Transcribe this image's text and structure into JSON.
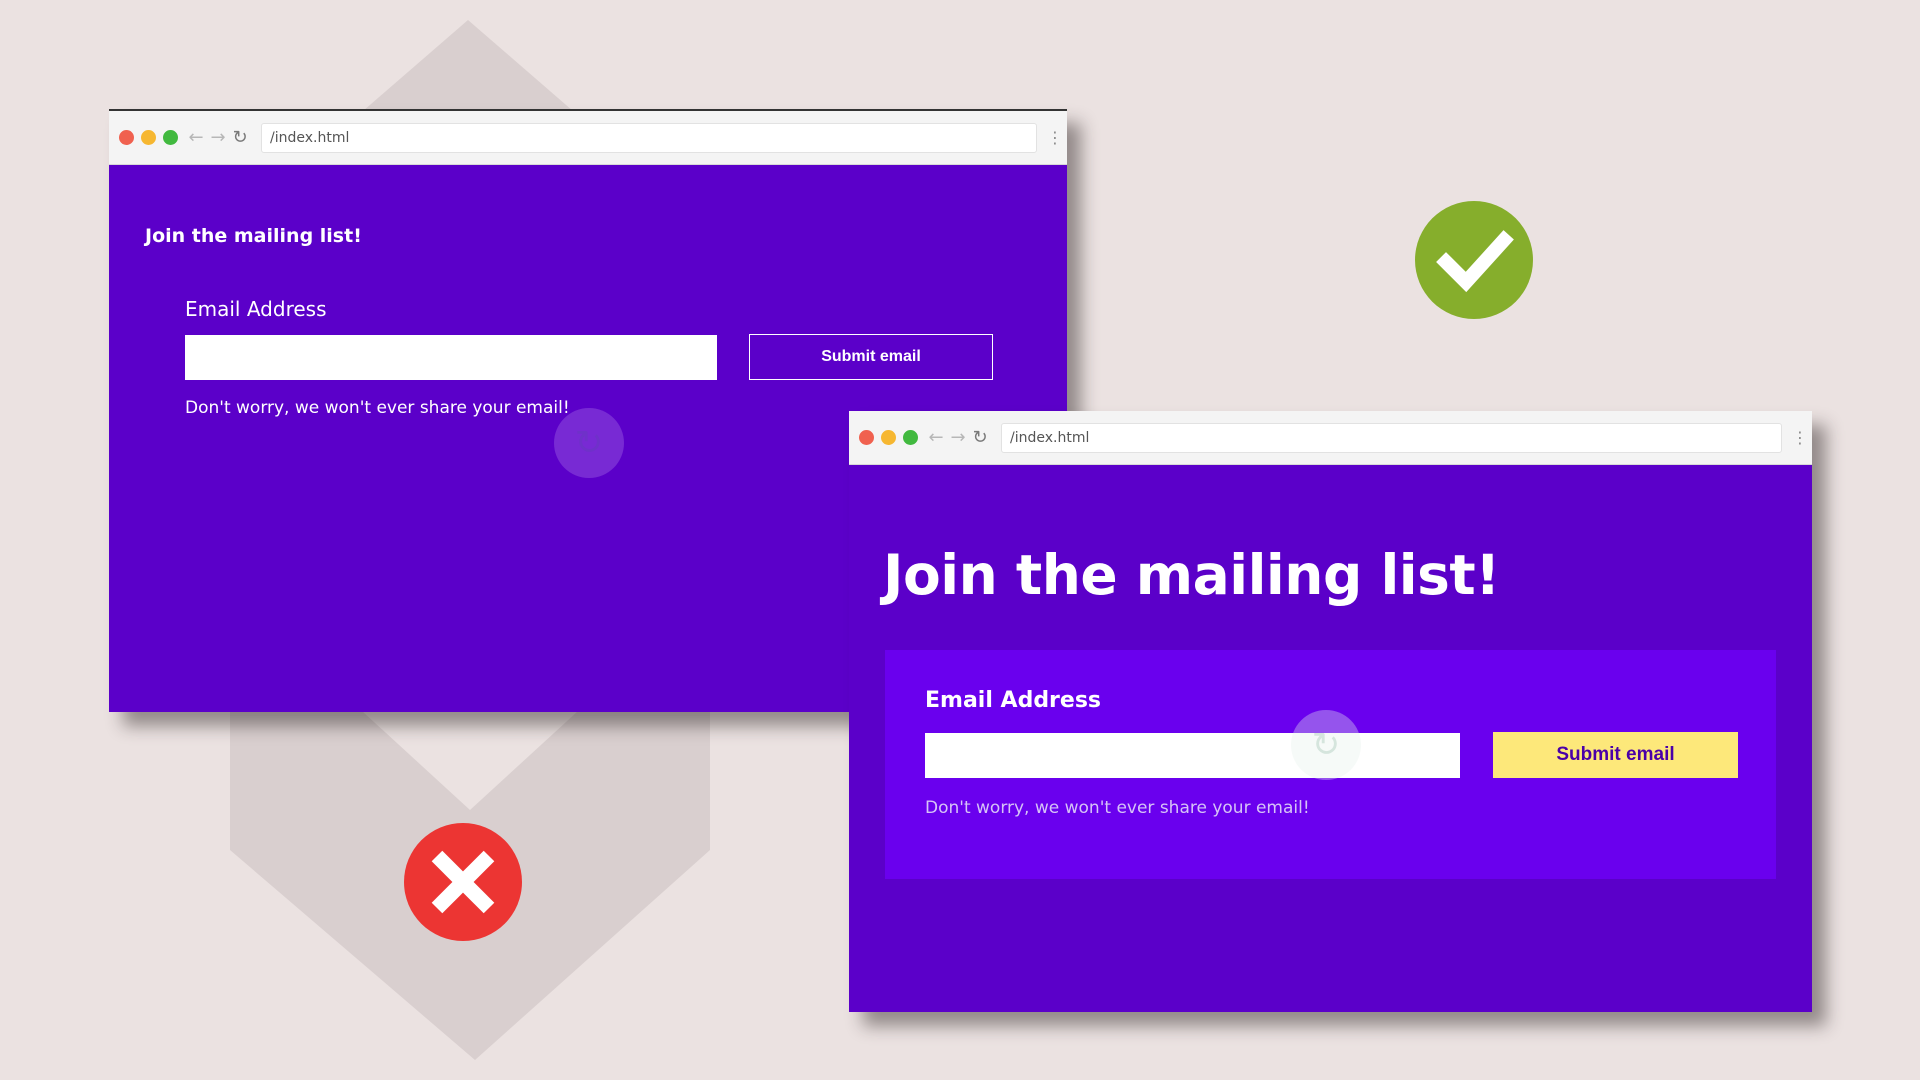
{
  "colors": {
    "background": "#ebe2e1",
    "page_purple": "#5b00c9",
    "card_purple": "#6a00ee",
    "button_yellow": "#fde87a",
    "check_green": "#86ae2c",
    "cross_red": "#ec3533"
  },
  "bad_example": {
    "url": "/index.html",
    "title": "Join the mailing list!",
    "email_label": "Email Address",
    "email_value": "",
    "submit_label": "Submit email",
    "helper_text": "Don't worry, we won't ever share your email!",
    "verdict_icon": "cross-icon"
  },
  "good_example": {
    "url": "/index.html",
    "title": "Join the mailing list!",
    "email_label": "Email Address",
    "email_value": "",
    "submit_label": "Submit email",
    "helper_text": "Don't worry, we won't ever share your email!",
    "verdict_icon": "checkmark-icon"
  },
  "browser_icons": [
    "close-dot-icon",
    "minimize-dot-icon",
    "maximize-dot-icon",
    "back-arrow-icon",
    "forward-arrow-icon",
    "reload-icon",
    "kebab-menu-icon"
  ]
}
